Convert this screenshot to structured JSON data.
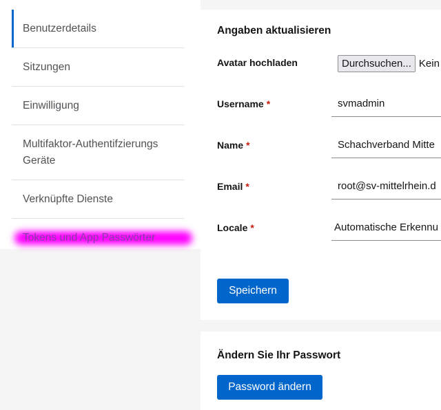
{
  "sidebar": {
    "items": [
      {
        "label": "Benutzerdetails",
        "active": true
      },
      {
        "label": "Sitzungen"
      },
      {
        "label": "Einwilligung"
      },
      {
        "label": "Multifaktor-Authentifzierungs Geräte"
      },
      {
        "label": "Verknüpfte Dienste"
      },
      {
        "label": "Tokens und App Passwörter",
        "highlight_color": "#ff00ff"
      }
    ],
    "active_color": "#0066cc"
  },
  "account_form": {
    "title": "Angaben aktualisieren",
    "avatar": {
      "label": "Avatar hochladen",
      "button_label": "Durchsuchen...",
      "status": "Kein"
    },
    "username": {
      "label": "Username",
      "required": "*",
      "value": "svmadmin"
    },
    "name": {
      "label": "Name",
      "required": "*",
      "value": "Schachverband Mitte"
    },
    "email": {
      "label": "Email",
      "required": "*",
      "value": "root@sv-mittelrhein.d"
    },
    "locale": {
      "label": "Locale",
      "required": "*",
      "value": "Automatische Erkennu"
    },
    "save_label": "Speichern"
  },
  "password_section": {
    "title": "Ändern Sie Ihr Passwort",
    "button_label": "Password ändern"
  },
  "colors": {
    "primary": "#0066cc",
    "required": "#c9190b",
    "background": "#f5f5f5"
  }
}
